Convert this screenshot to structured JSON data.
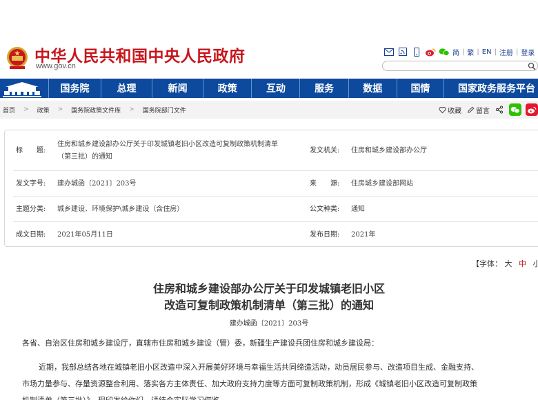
{
  "header": {
    "site_title": "中华人民共和国中央人民政府",
    "site_url": "www.gov.cn",
    "links": [
      "简",
      "繁",
      "EN",
      "注册",
      "登录"
    ],
    "search_placeholder": ""
  },
  "nav": {
    "items": [
      "国务院",
      "总理",
      "新闻",
      "政策",
      "互动",
      "服务",
      "数据",
      "国情",
      "国家政务服务平台"
    ]
  },
  "breadcrumb": {
    "items": [
      "首页",
      "政策",
      "国务院政策文件库",
      "国务院部门文件"
    ],
    "actions": {
      "favorite": "收藏",
      "comment": "留言"
    }
  },
  "info": {
    "title_label": "标　　题:",
    "title_value_line1": "住房和城乡建设部办公厅关于印发城镇老旧小区改造可复制政策机制清单",
    "title_value_line2": "（第三批）的通知",
    "issuer_label": "发文机关:",
    "issuer_value": "住房和城乡建设部办公厅",
    "docno_label": "发文字号:",
    "docno_value": "建办城函〔2021〕203号",
    "source_label": "来　　源:",
    "source_value": "住房城乡建设部网站",
    "topic_label": "主题分类:",
    "topic_value": "城乡建设、环境保护\\城乡建设（含住房）",
    "type_label": "公文种类:",
    "type_value": "通知",
    "written_label": "成文日期:",
    "written_value": "2021年05月11日",
    "published_label": "发布日期:",
    "published_value": "2021年"
  },
  "font_control": {
    "prefix": "【字体：",
    "large": "大",
    "medium": "中",
    "small": "小"
  },
  "article": {
    "title_line1": "住房和城乡建设部办公厅关于印发城镇老旧小区",
    "title_line2": "改造可复制政策机制清单（第三批）的通知",
    "doc_no": "建办城函〔2021〕203号",
    "para1": "各省、自治区住房和城乡建设厅，直辖市住房和城乡建设（管）委，新疆生产建设兵团住房和城乡建设局：",
    "para2_line1": "近期，我部总结各地在城镇老旧小区改造中深入开展美好环境与幸福生活共同缔造活动，动员居民参与、改造项目生成、金融支持、",
    "para2_line2": "市场力量参与、存量资源整合利用、落实各方主体责任、加大政府支持力度等方面可复制政策机制，形成《城镇老旧小区改造可复制政策",
    "para2_line3": "机制清单（第三批）》，现印发给你们，请结合实际学习借鉴。"
  },
  "colors": {
    "brand_red": "#c8161d",
    "nav_blue": "#0d4a9e"
  }
}
